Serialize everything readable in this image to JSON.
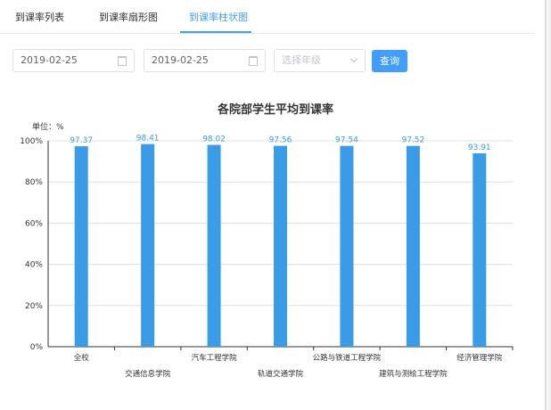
{
  "tabs": [
    {
      "label": "到课率列表",
      "active": false
    },
    {
      "label": "到课率扇形图",
      "active": false
    },
    {
      "label": "到课率柱状图",
      "active": true
    }
  ],
  "filters": {
    "start_date": "2019-02-25",
    "end_date": "2019-02-25",
    "grade_placeholder": "选择年级",
    "query_button": "查询"
  },
  "colors": {
    "accent": "#409eff",
    "bar": "#3a9ce6"
  },
  "chart_data": {
    "type": "bar",
    "title": "各院部学生平均到课率",
    "unit_label": "单位：%",
    "categories": [
      "全校",
      "交通信息学院",
      "汽车工程学院",
      "轨道交通学院",
      "公路与铁道工程学院",
      "建筑与测绘工程学院",
      "经济管理学院"
    ],
    "values": [
      97.37,
      98.41,
      98.02,
      97.56,
      97.54,
      97.52,
      93.91
    ],
    "value_labels": [
      "97.37",
      "98.41",
      "98.02",
      "97.56",
      "97.54",
      "97.52",
      "93.91"
    ],
    "y_ticks": [
      "0%",
      "20%",
      "40%",
      "60%",
      "80%",
      "100%"
    ],
    "ylim": [
      0,
      100
    ],
    "grid": true,
    "legend": "none"
  }
}
